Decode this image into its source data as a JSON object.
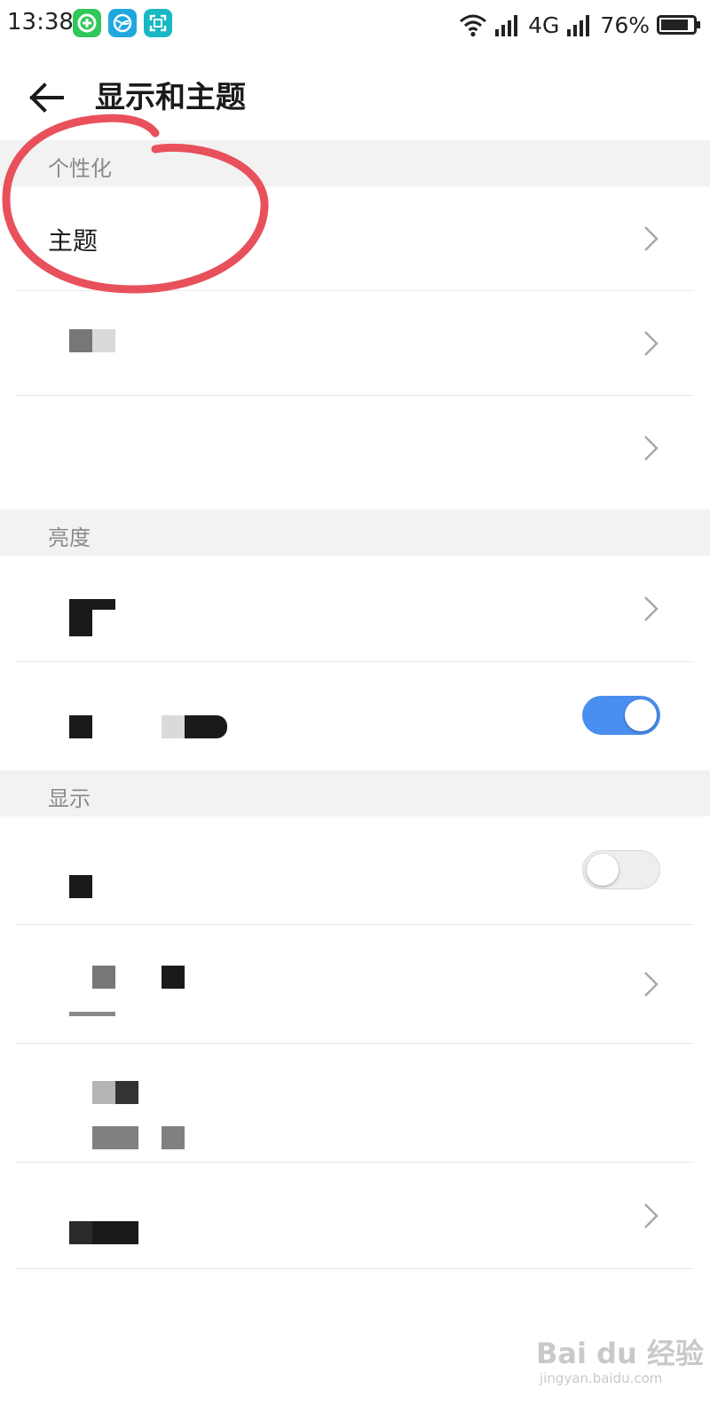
{
  "status_bar": {
    "time": "13:38",
    "network": "4G",
    "battery": "76%",
    "icons": [
      "app-green-icon",
      "app-blue-icon",
      "app-scan-icon",
      "wifi-icon",
      "signal-icon",
      "signal-icon",
      "battery-icon"
    ]
  },
  "header": {
    "title": "显示和主题",
    "back_icon": "back-arrow-icon"
  },
  "sections": [
    {
      "title": "个性化",
      "rows": [
        {
          "label": "主题",
          "control": "chevron"
        },
        {
          "label": "",
          "control": "chevron"
        },
        {
          "label": "",
          "control": "chevron"
        }
      ]
    },
    {
      "title": "亮度",
      "rows": [
        {
          "label": "",
          "control": "chevron"
        },
        {
          "label": "",
          "control": "toggle",
          "on": true
        }
      ]
    },
    {
      "title": "显示",
      "rows": [
        {
          "label": "",
          "control": "toggle",
          "on": false
        },
        {
          "label": "",
          "control": "chevron"
        },
        {
          "label": "",
          "control": "none"
        },
        {
          "label": "",
          "control": "chevron"
        }
      ]
    }
  ],
  "colors": {
    "accent": "#4a8ef0",
    "annotation": "#e8505b",
    "section_bg": "#f2f2f2"
  },
  "watermark": {
    "logo": "Bai du 经验",
    "url": "jingyan.baidu.com"
  }
}
